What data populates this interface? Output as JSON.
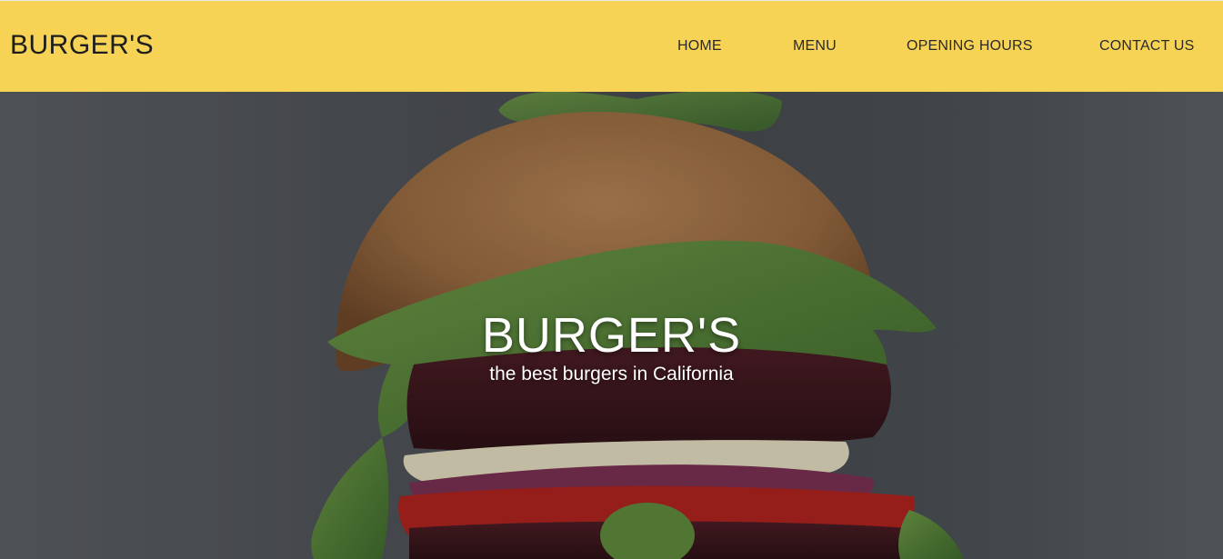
{
  "header": {
    "logo": "BURGER'S",
    "nav": [
      {
        "label": "HOME"
      },
      {
        "label": "MENU"
      },
      {
        "label": "OPENING HOURS"
      },
      {
        "label": "CONTACT US"
      }
    ]
  },
  "hero": {
    "title": "BURGER'S",
    "subtitle": "the best burgers in California"
  },
  "colors": {
    "navbar_bg": "#f6d354",
    "text_dark": "#1d1d1d",
    "hero_text": "#ffffff"
  }
}
